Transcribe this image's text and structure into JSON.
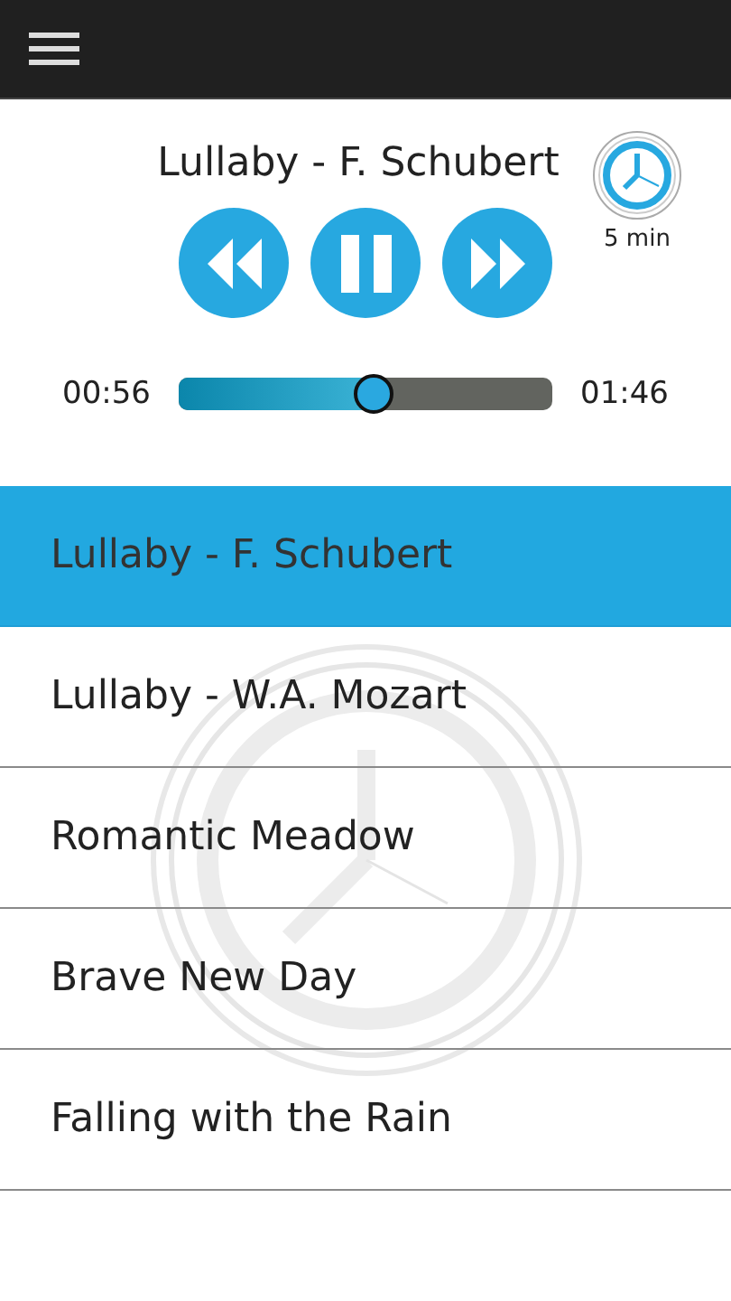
{
  "now_playing": {
    "title": "Lullaby - F. Schubert",
    "timer": "5 min",
    "elapsed": "00:56",
    "total": "01:46",
    "level": 0.52,
    "playing": true
  },
  "tracks": [
    {
      "title": "Lullaby - F. Schubert",
      "selected": true
    },
    {
      "title": "Lullaby - W.A. Mozart",
      "selected": false
    },
    {
      "title": "Romantic Meadow",
      "selected": false
    },
    {
      "title": "Brave New Day",
      "selected": false
    },
    {
      "title": "Falling with the Rain",
      "selected": false
    }
  ]
}
